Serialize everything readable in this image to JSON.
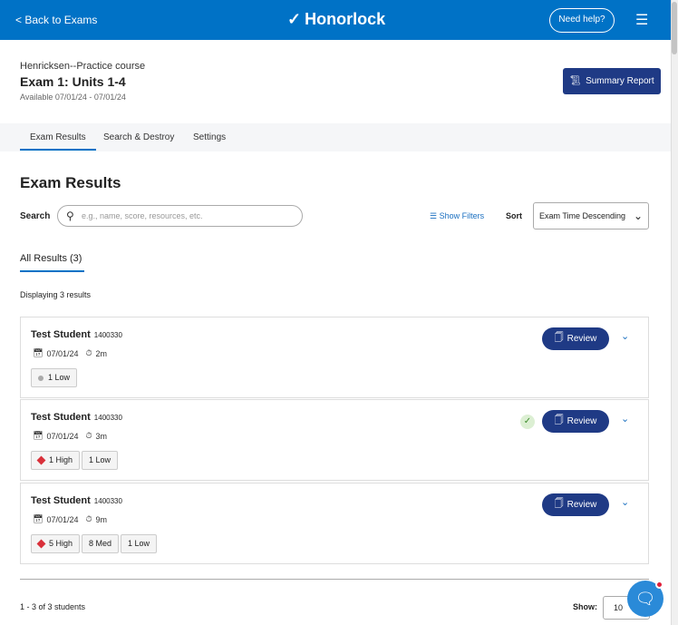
{
  "header": {
    "back": "Back to Exams",
    "brand": "Honorlock",
    "help": "Need help?"
  },
  "exam": {
    "course": "Henricksen--Practice course",
    "title": "Exam 1: Units 1-4",
    "available": "Available 07/01/24 - 07/01/24",
    "summary_button": "Summary Report"
  },
  "tabs": [
    {
      "label": "Exam Results"
    },
    {
      "label": "Search & Destroy"
    },
    {
      "label": "Settings"
    }
  ],
  "main": {
    "heading": "Exam Results",
    "search_label": "Search",
    "search_placeholder": "e.g., name, score, resources, etc.",
    "show_filters": "Show Filters",
    "sort_label": "Sort",
    "sort_value": "Exam Time Descending",
    "all_results": "All Results (3)",
    "displaying": "Displaying 3 results"
  },
  "results": [
    {
      "name": "Test Student",
      "id": "1400330",
      "date": "07/01/24",
      "duration": "2m",
      "badges": [
        "1 Low"
      ],
      "reviewed": false,
      "review": "Review"
    },
    {
      "name": "Test Student",
      "id": "1400330",
      "date": "07/01/24",
      "duration": "3m",
      "badges": [
        "1 High",
        "1 Low"
      ],
      "reviewed": true,
      "review": "Review"
    },
    {
      "name": "Test Student",
      "id": "1400330",
      "date": "07/01/24",
      "duration": "9m",
      "badges": [
        "5 High",
        "8 Med",
        "1 Low"
      ],
      "reviewed": false,
      "review": "Review"
    }
  ],
  "footer": {
    "count": "1 - 3 of 3 students",
    "show_label": "Show:",
    "show_value": "10"
  },
  "colors": {
    "brand": "#0072c6",
    "button": "#1f3a85",
    "high": "#d9303a"
  }
}
